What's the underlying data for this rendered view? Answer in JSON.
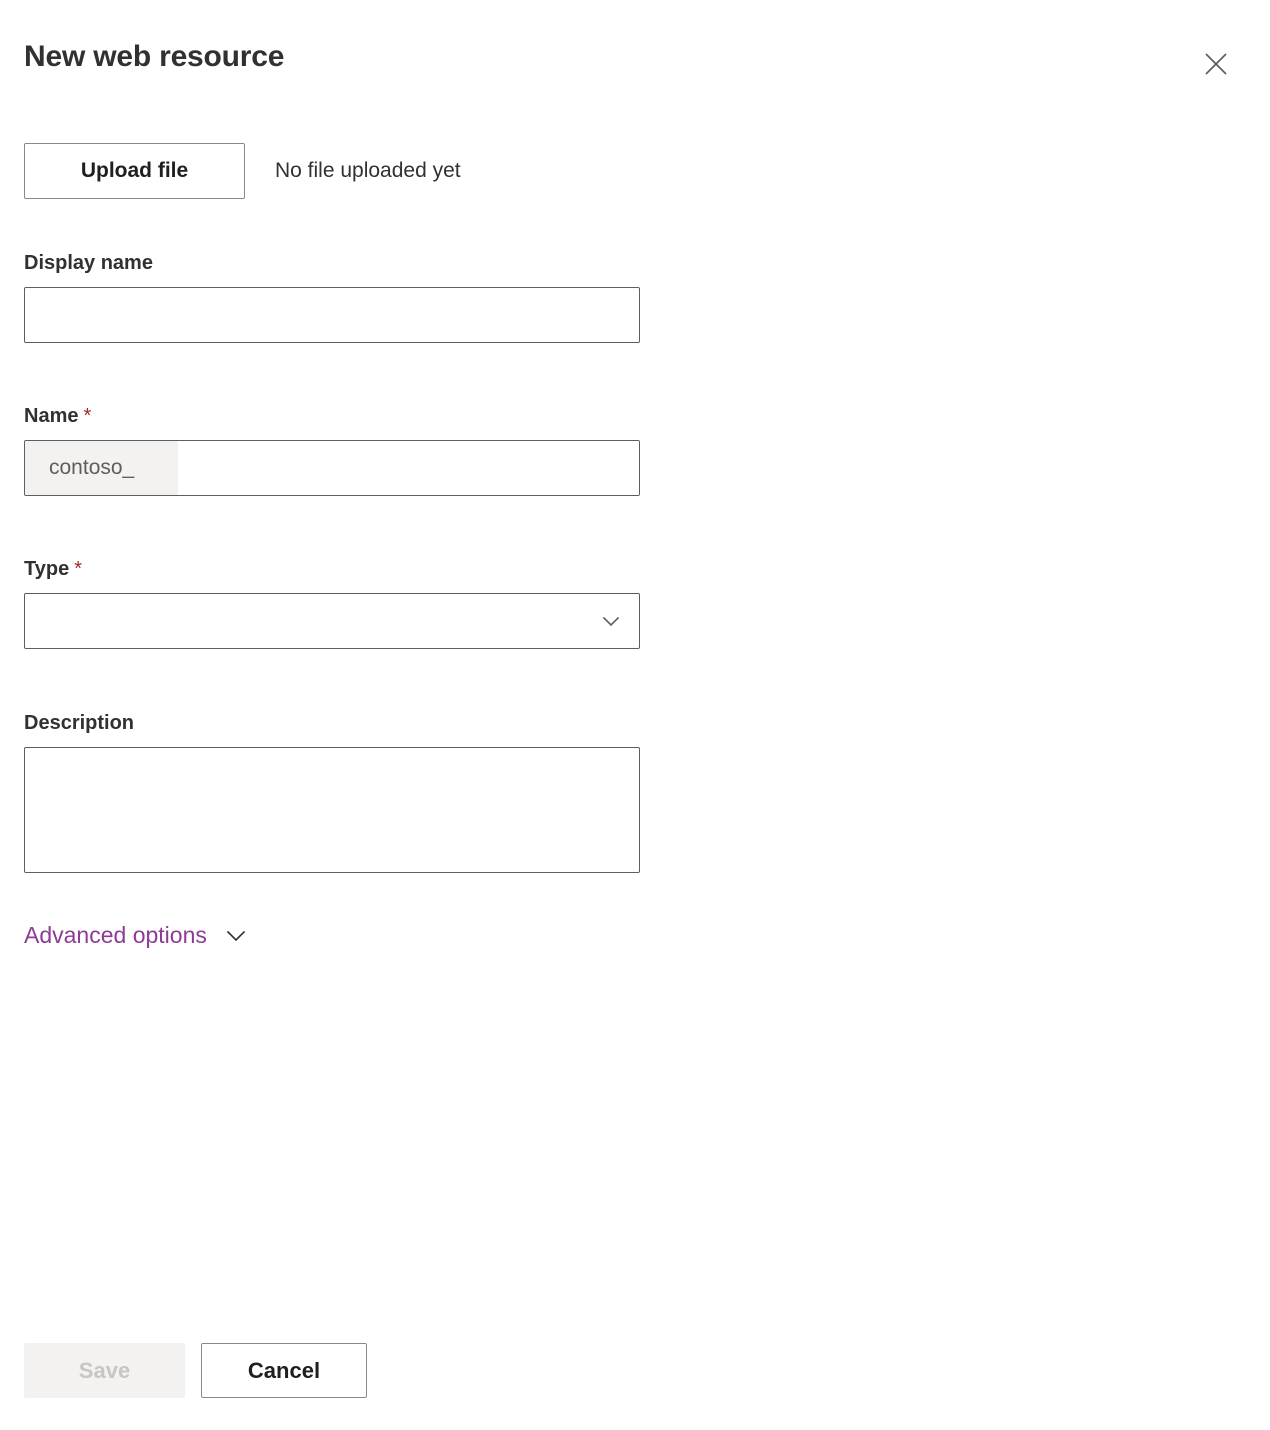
{
  "panel": {
    "title": "New web resource",
    "close_icon": "close-icon"
  },
  "upload": {
    "button_label": "Upload file",
    "status_text": "No file uploaded yet"
  },
  "fields": {
    "display_name": {
      "label": "Display name",
      "value": "",
      "placeholder": ""
    },
    "name": {
      "label": "Name",
      "required_marker": "*",
      "prefix": "contoso_",
      "value": "",
      "placeholder": ""
    },
    "type": {
      "label": "Type",
      "required_marker": "*",
      "selected": "",
      "placeholder": "",
      "chevron_icon": "chevron-down-icon"
    },
    "description": {
      "label": "Description",
      "value": "",
      "placeholder": ""
    }
  },
  "advanced_options": {
    "label": "Advanced options",
    "chevron_icon": "chevron-down-icon",
    "expanded": false
  },
  "footer": {
    "save_label": "Save",
    "save_disabled": true,
    "cancel_label": "Cancel"
  },
  "colors": {
    "accent_purple": "#8f3a96",
    "required_red": "#a4262c",
    "text_primary": "#323130",
    "border": "#605e5c",
    "disabled_text": "#c8c6c4",
    "prefix_bg": "#f3f2f1"
  }
}
